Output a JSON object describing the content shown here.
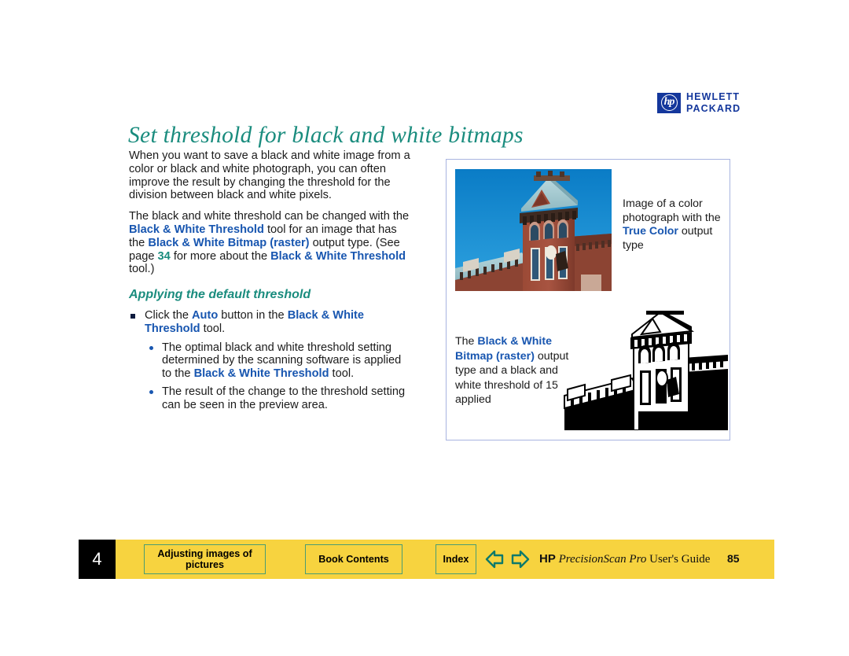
{
  "logo": {
    "mark": "hp",
    "line1": "HEWLETT",
    "line2": "PACKARD"
  },
  "title": "Set threshold for black and white bitmaps",
  "body": {
    "paragraph1": "When you want to save a black and white image from a color or black and white photograph, you can often improve the result by changing the threshold for the division between black and white pixels.",
    "paragraph2_part1": "The black and white threshold can be changed with the ",
    "paragraph2_term1": "Black & White Threshold",
    "paragraph2_part2": " tool for an image that has the ",
    "paragraph2_term2": "Black & White Bitmap (raster)",
    "paragraph2_part3": " output type. (See page ",
    "paragraph2_pageref": "34",
    "paragraph2_part4": " for more about the ",
    "paragraph2_term3": "Black & White Threshold",
    "paragraph2_part5": " tool.)",
    "subheading": "Applying the default threshold",
    "bullet1_part1": "Click the ",
    "bullet1_term1": "Auto",
    "bullet1_part2": " button in the ",
    "bullet1_term2": "Black & White Threshold",
    "bullet1_part3": " tool.",
    "subbullet1_part1": "The optimal black and white threshold setting determined by the scanning software is applied to the ",
    "subbullet1_term": "Black & White Threshold",
    "subbullet1_part2": " tool.",
    "subbullet2": "The result of the change to the threshold setting can be seen in the preview area."
  },
  "figures": {
    "top": {
      "alt": "color-photograph-of-victorian-building-tower",
      "caption_part1": "Image of a color photograph with the ",
      "caption_term": "True Color",
      "caption_part2": " output type"
    },
    "bottom": {
      "alt": "black-and-white-bitmap-of-victorian-building-tower",
      "caption_part1": "The ",
      "caption_term1": "Black & White Bitmap (raster)",
      "caption_part2": " output type and a black and white threshold of 15 applied"
    }
  },
  "footer": {
    "chapter": "4",
    "btn_pictures": "Adjusting images of pictures",
    "btn_contents": "Book Contents",
    "btn_index": "Index",
    "brand_hp": "HP",
    "brand_product": "PrecisionScan Pro",
    "brand_guide": "User's Guide",
    "page_number": "85"
  },
  "colors": {
    "title_teal": "#1a8c7e",
    "link_blue": "#1856b0",
    "footer_yellow": "#f7d33f",
    "button_border_green": "#4a9d73",
    "hp_blue": "#14379c",
    "panel_border": "#a8b4e0"
  }
}
